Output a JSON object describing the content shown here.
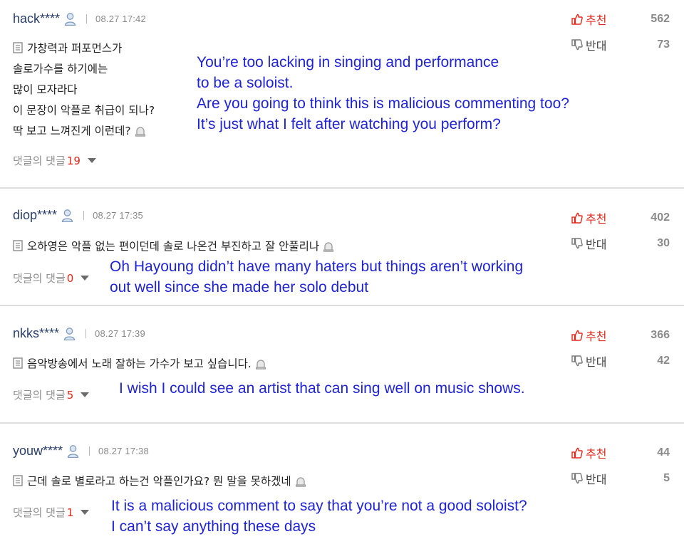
{
  "reply_label": "댓글의 댓글",
  "vote_up_label": "추천",
  "vote_down_label": "반대",
  "colors": {
    "username": "#2a3f6c",
    "up": "#e0281a",
    "reply_count": "#e0281a",
    "translation": "#1f23d6",
    "divider": "#dedede"
  },
  "icons": {
    "user": "user-icon",
    "document": "document-icon",
    "report": "report-icon",
    "thumbs_up": "thumbs-up-icon",
    "thumbs_down": "thumbs-down-icon",
    "caret": "caret-down-icon"
  },
  "comments": [
    {
      "username": "hack****",
      "timestamp": "08.27 17:42",
      "text": "가창력과 퍼포먼스가\n솔로가수를 하기에는\n많이 모자라다\n이 문장이 악플로 취급이 되나?\n딱 보고 느껴진게 이런데?",
      "reply_count": "19",
      "up": "562",
      "down": "73",
      "translation": "You’re too lacking in singing and performance\nto be a soloist.\nAre you going to think this is malicious commenting too?\nIt’s just what I felt after watching you perform?"
    },
    {
      "username": "diop****",
      "timestamp": "08.27 17:35",
      "text": "오하영은 악플 없는 편이던데 솔로 나온건 부진하고 잘 안풀리나",
      "reply_count": "0",
      "up": "402",
      "down": "30",
      "translation": "Oh Hayoung didn’t have many haters but things aren’t working\nout well since she made her solo debut"
    },
    {
      "username": "nkks****",
      "timestamp": "08.27 17:39",
      "text": "음악방송에서 노래 잘하는 가수가 보고 싶습니다.",
      "reply_count": "5",
      "up": "366",
      "down": "42",
      "translation": "I wish I could see an artist that can sing well on music shows."
    },
    {
      "username": "youw****",
      "timestamp": "08.27 17:38",
      "text": "근데 솔로 별로라고 하는건 악플인가요? 뭔 말을 못하겠네",
      "reply_count": "1",
      "up": "44",
      "down": "5",
      "translation": "It is a malicious comment to say that you’re not a good soloist?\nI can’t say anything these days"
    }
  ]
}
